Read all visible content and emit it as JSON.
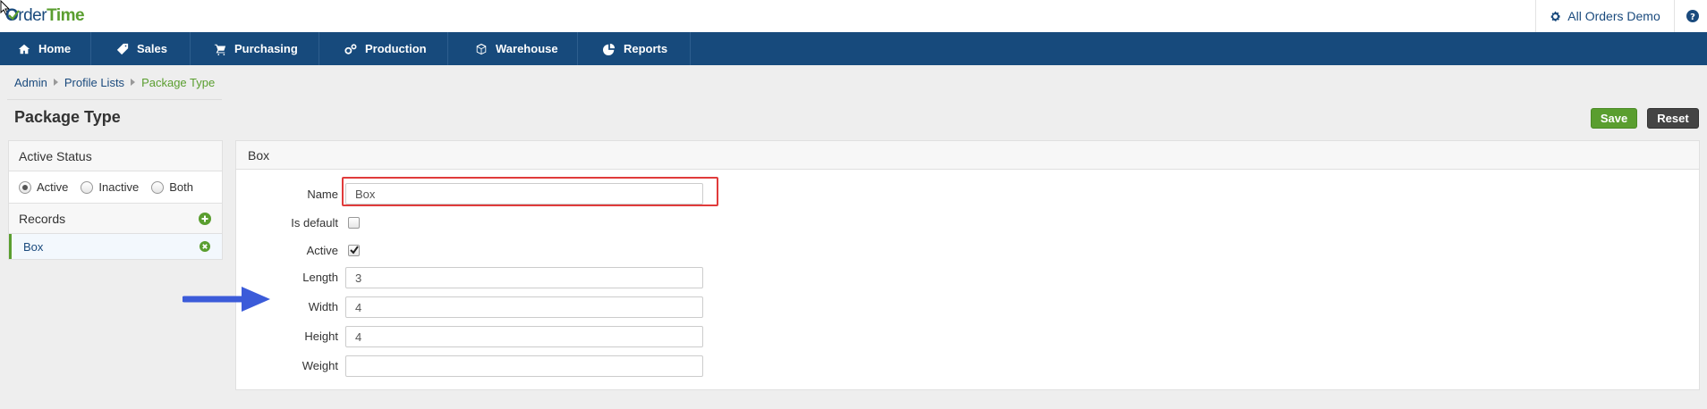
{
  "app": {
    "logo": {
      "o": "O",
      "rder": "rder",
      "time": "Time"
    },
    "company": "All Orders Demo"
  },
  "nav": [
    {
      "label": "Home",
      "icon": "home-icon"
    },
    {
      "label": "Sales",
      "icon": "tag-icon"
    },
    {
      "label": "Purchasing",
      "icon": "cart-icon"
    },
    {
      "label": "Production",
      "icon": "gears-icon"
    },
    {
      "label": "Warehouse",
      "icon": "cube-icon"
    },
    {
      "label": "Reports",
      "icon": "pie-chart-icon"
    }
  ],
  "breadcrumb": {
    "admin": "Admin",
    "profile_lists": "Profile Lists",
    "current": "Package Type"
  },
  "page": {
    "title": "Package Type"
  },
  "actions": {
    "save": "Save",
    "reset": "Reset"
  },
  "sidebar": {
    "active_status": "Active Status",
    "status_options": {
      "active": "Active",
      "inactive": "Inactive",
      "both": "Both"
    },
    "selected_status": "Active",
    "records_title": "Records",
    "records": [
      {
        "label": "Box"
      }
    ]
  },
  "form": {
    "title": "Box",
    "name_label": "Name",
    "name_value": "Box",
    "is_default_label": "Is default",
    "is_default_checked": false,
    "active_label": "Active",
    "active_checked": true,
    "length_label": "Length",
    "length_value": "3",
    "width_label": "Width",
    "width_value": "4",
    "height_label": "Height",
    "height_value": "4",
    "weight_label": "Weight",
    "weight_value": ""
  },
  "colors": {
    "nav_bg": "#174a7c",
    "brand_green": "#5a9e2f",
    "highlight_red": "#e03b3b",
    "annotation_arrow": "#3b5bd9"
  }
}
